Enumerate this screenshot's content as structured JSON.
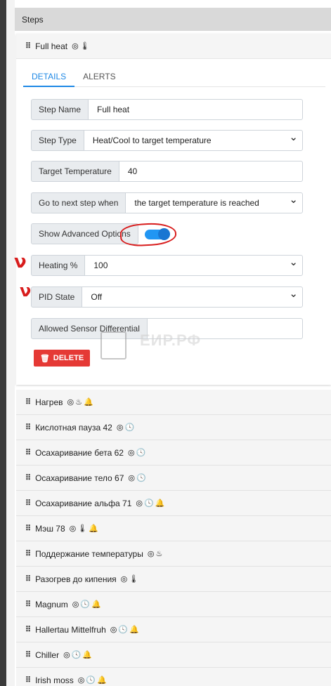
{
  "steps_header": "Steps",
  "active_step": {
    "title": "Full heat",
    "icons": [
      "target-icon",
      "thermometer-icon"
    ],
    "tabs": [
      {
        "label": "DETAILS",
        "active": true
      },
      {
        "label": "ALERTS",
        "active": false
      }
    ],
    "fields": {
      "step_name": {
        "label": "Step Name",
        "value": "Full heat"
      },
      "step_type": {
        "label": "Step Type",
        "value": "Heat/Cool to target temperature"
      },
      "target_temperature": {
        "label": "Target Temperature",
        "value": "40"
      },
      "next_step": {
        "label": "Go to next step when",
        "value": "the target temperature is reached"
      },
      "advanced_options": {
        "label": "Show Advanced Options",
        "enabled": true
      },
      "heating": {
        "label": "Heating %",
        "value": "100"
      },
      "pid_state": {
        "label": "PID State",
        "value": "Off"
      },
      "allowed_sensor": {
        "label": "Allowed Sensor Differential",
        "value": ""
      }
    },
    "delete_label": "DELETE",
    "watermark": "ЕИР.РФ"
  },
  "steps": [
    {
      "title": "Нагрев",
      "icons": [
        "target-icon",
        "flame-icon",
        "bell-icon"
      ]
    },
    {
      "title": "Кислотная пауза 42",
      "icons": [
        "target-icon",
        "clock-icon"
      ]
    },
    {
      "title": "Осахаривание бета 62",
      "icons": [
        "target-icon",
        "clock-icon"
      ]
    },
    {
      "title": "Осахаривание тело 67",
      "icons": [
        "target-icon",
        "clock-icon"
      ]
    },
    {
      "title": "Осахаривание альфа 71",
      "icons": [
        "target-icon",
        "clock-icon",
        "bell-icon"
      ]
    },
    {
      "title": "Мэш 78",
      "icons": [
        "target-icon",
        "thermometer-icon",
        "bell-icon"
      ]
    },
    {
      "title": "Поддержание температуры",
      "icons": [
        "target-icon",
        "flame-icon"
      ]
    },
    {
      "title": "Разогрев до кипения",
      "icons": [
        "target-icon",
        "thermometer-icon"
      ]
    },
    {
      "title": "Magnum",
      "icons": [
        "target-icon",
        "clock-icon",
        "bell-icon"
      ]
    },
    {
      "title": "Hallertau Mittelfruh",
      "icons": [
        "target-icon",
        "clock-icon",
        "bell-icon"
      ]
    },
    {
      "title": "Chiller",
      "icons": [
        "target-icon",
        "clock-icon",
        "bell-icon"
      ]
    },
    {
      "title": "Irish moss",
      "icons": [
        "target-icon",
        "clock-icon",
        "bell-icon"
      ]
    }
  ],
  "colors": {
    "accent": "#1e88e5",
    "delete": "#e53935",
    "annotation": "#d81d1d"
  }
}
